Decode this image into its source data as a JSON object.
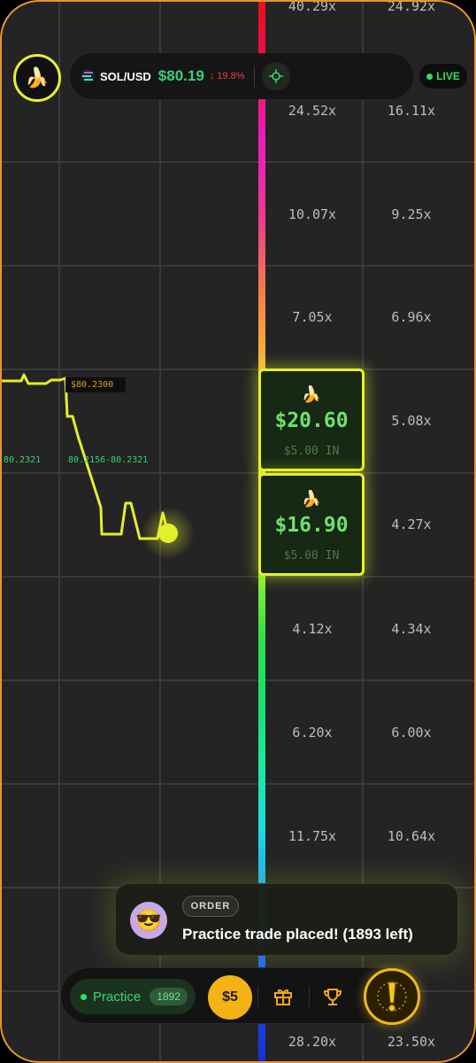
{
  "header": {
    "avatar_emoji": "🍌",
    "pair": "SOL/USD",
    "price": "$80.19",
    "change": "↓ 19.8%",
    "live_label": "LIVE"
  },
  "chart": {
    "price_tag": "$80.2300",
    "left_range": "80.2321",
    "mid_range": "80.2156-80.2321"
  },
  "multipliers": {
    "col1": [
      "40.29x",
      "24.52x",
      "10.07x",
      "7.05x",
      "4.12x",
      "6.20x",
      "11.75x",
      "28.20x"
    ],
    "col2": [
      "24.92x",
      "16.11x",
      "9.25x",
      "6.96x",
      "5.08x",
      "4.27x",
      "4.34x",
      "6.00x",
      "10.64x",
      "23.50x"
    ]
  },
  "bets": [
    {
      "emoji": "🍌",
      "amount": "$20.60",
      "stake": "$5.00 IN"
    },
    {
      "emoji": "🍌",
      "amount": "$16.90",
      "stake": "$5.00 IN"
    }
  ],
  "toast": {
    "tag": "ORDER",
    "message": "Practice trade placed! (1893 left)"
  },
  "bottom_bar": {
    "mode_label": "Practice",
    "mode_count": "1892",
    "bet_label": "$5"
  },
  "colors": {
    "accent": "#e5f02a",
    "frame": "#e8952a",
    "positive": "#3ad07a",
    "negative": "#e84040"
  }
}
